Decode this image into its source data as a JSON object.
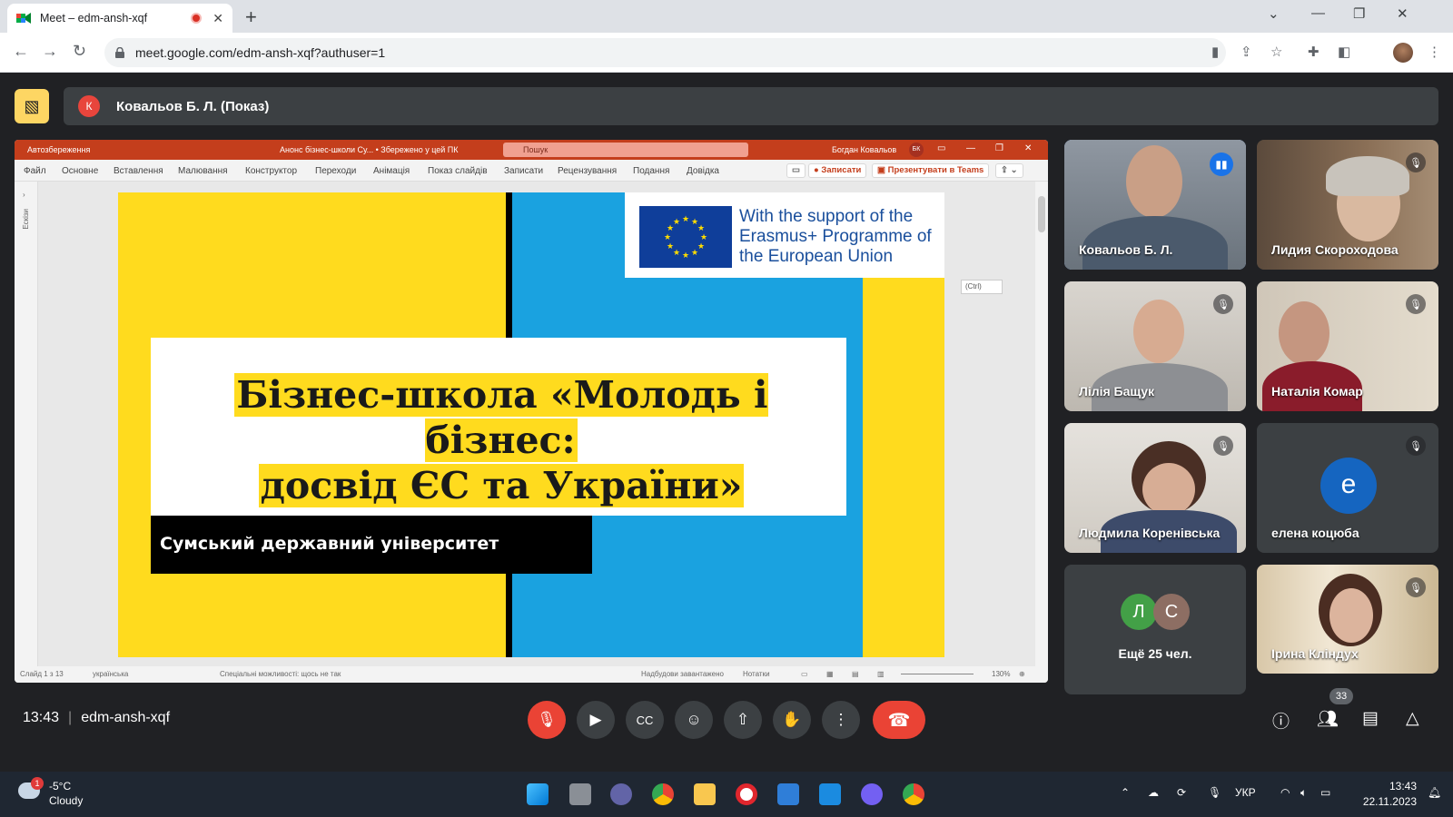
{
  "browser": {
    "tab_title": "Meet – edm-ansh-xqf",
    "url": "meet.google.com/edm-ansh-xqf?authuser=1"
  },
  "meet": {
    "presenter_initial": "К",
    "presenting_label": "Ковальов Б. Л. (Показ)",
    "time": "13:43",
    "meeting_code": "edm-ansh-xqf",
    "participant_count": "33",
    "participants": [
      {
        "name": "Ковальов Б. Л."
      },
      {
        "name": "Лидия Скороходова"
      },
      {
        "name": "Лілія Бащук"
      },
      {
        "name": "Наталія Комар"
      },
      {
        "name": "Людмила Коренівська"
      },
      {
        "name": "елена коцюба",
        "initial": "е"
      },
      {
        "name": "Ірина Кліндух"
      }
    ],
    "more": {
      "initials": [
        "Л",
        "С"
      ],
      "label": "Ещё 25 чел."
    }
  },
  "ppt": {
    "autosave": "Автозбереження",
    "doc_title": "Анонс бізнес-школи Су... • Збережено у цей ПК",
    "search": "Пошук",
    "user": "Богдан Ковальов",
    "user_initials": "БК",
    "menu": [
      "Файл",
      "Основне",
      "Вставлення",
      "Малювання",
      "Конструктор",
      "Переходи",
      "Анімація",
      "Показ слайдів",
      "Записати",
      "Рецензування",
      "Подання",
      "Довідка"
    ],
    "record_btn": "Записати",
    "teams_btn": "Презентувати в Teams",
    "side_label": "Ескізи",
    "ctrl_tag": "(Ctrl)",
    "status": {
      "slide": "Слайд 1 з 13",
      "lang": "українська",
      "access": "Спеціальні можливості: щось не так",
      "loading": "Надбудови завантажено",
      "notes": "Нотатки",
      "zoom": "130%"
    }
  },
  "slide": {
    "eu_text": "With the support of the Erasmus+ Programme of the European Union",
    "title_line1": "Бізнес-школа «Молодь і бізнес:",
    "title_line2": "досвід ЄС та України»",
    "university": "Сумський державний університет"
  },
  "taskbar": {
    "weather_badge": "1",
    "temp": "-5°C",
    "condition": "Cloudy",
    "lang": "УКР",
    "time": "13:43",
    "date": "22.11.2023"
  },
  "colors": {
    "ukr_yellow": "#ffdb1e",
    "ukr_blue": "#1aa2e0",
    "meet_red": "#ea4335",
    "ppt_red": "#c43e1c"
  }
}
